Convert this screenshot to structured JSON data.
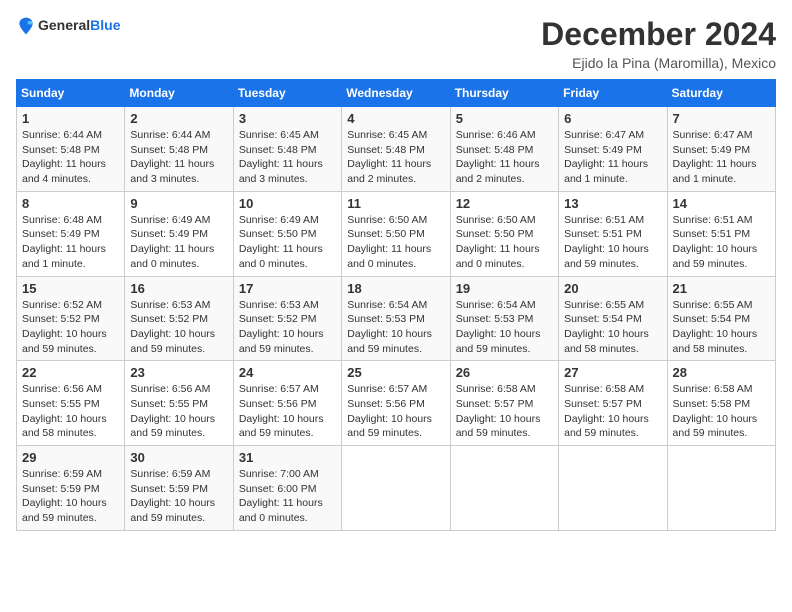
{
  "header": {
    "logo_general": "General",
    "logo_blue": "Blue",
    "title": "December 2024",
    "subtitle": "Ejido la Pina (Maromilla), Mexico"
  },
  "calendar": {
    "columns": [
      "Sunday",
      "Monday",
      "Tuesday",
      "Wednesday",
      "Thursday",
      "Friday",
      "Saturday"
    ],
    "weeks": [
      [
        null,
        null,
        null,
        null,
        null,
        null,
        null
      ]
    ],
    "days": {
      "1": {
        "sunrise": "6:44 AM",
        "sunset": "5:48 PM",
        "daylight": "11 hours and 4 minutes."
      },
      "2": {
        "sunrise": "6:44 AM",
        "sunset": "5:48 PM",
        "daylight": "11 hours and 3 minutes."
      },
      "3": {
        "sunrise": "6:45 AM",
        "sunset": "5:48 PM",
        "daylight": "11 hours and 3 minutes."
      },
      "4": {
        "sunrise": "6:45 AM",
        "sunset": "5:48 PM",
        "daylight": "11 hours and 2 minutes."
      },
      "5": {
        "sunrise": "6:46 AM",
        "sunset": "5:48 PM",
        "daylight": "11 hours and 2 minutes."
      },
      "6": {
        "sunrise": "6:47 AM",
        "sunset": "5:49 PM",
        "daylight": "11 hours and 1 minute."
      },
      "7": {
        "sunrise": "6:47 AM",
        "sunset": "5:49 PM",
        "daylight": "11 hours and 1 minute."
      },
      "8": {
        "sunrise": "6:48 AM",
        "sunset": "5:49 PM",
        "daylight": "11 hours and 1 minute."
      },
      "9": {
        "sunrise": "6:49 AM",
        "sunset": "5:49 PM",
        "daylight": "11 hours and 0 minutes."
      },
      "10": {
        "sunrise": "6:49 AM",
        "sunset": "5:50 PM",
        "daylight": "11 hours and 0 minutes."
      },
      "11": {
        "sunrise": "6:50 AM",
        "sunset": "5:50 PM",
        "daylight": "11 hours and 0 minutes."
      },
      "12": {
        "sunrise": "6:50 AM",
        "sunset": "5:50 PM",
        "daylight": "11 hours and 0 minutes."
      },
      "13": {
        "sunrise": "6:51 AM",
        "sunset": "5:51 PM",
        "daylight": "10 hours and 59 minutes."
      },
      "14": {
        "sunrise": "6:51 AM",
        "sunset": "5:51 PM",
        "daylight": "10 hours and 59 minutes."
      },
      "15": {
        "sunrise": "6:52 AM",
        "sunset": "5:52 PM",
        "daylight": "10 hours and 59 minutes."
      },
      "16": {
        "sunrise": "6:53 AM",
        "sunset": "5:52 PM",
        "daylight": "10 hours and 59 minutes."
      },
      "17": {
        "sunrise": "6:53 AM",
        "sunset": "5:52 PM",
        "daylight": "10 hours and 59 minutes."
      },
      "18": {
        "sunrise": "6:54 AM",
        "sunset": "5:53 PM",
        "daylight": "10 hours and 59 minutes."
      },
      "19": {
        "sunrise": "6:54 AM",
        "sunset": "5:53 PM",
        "daylight": "10 hours and 59 minutes."
      },
      "20": {
        "sunrise": "6:55 AM",
        "sunset": "5:54 PM",
        "daylight": "10 hours and 58 minutes."
      },
      "21": {
        "sunrise": "6:55 AM",
        "sunset": "5:54 PM",
        "daylight": "10 hours and 58 minutes."
      },
      "22": {
        "sunrise": "6:56 AM",
        "sunset": "5:55 PM",
        "daylight": "10 hours and 58 minutes."
      },
      "23": {
        "sunrise": "6:56 AM",
        "sunset": "5:55 PM",
        "daylight": "10 hours and 59 minutes."
      },
      "24": {
        "sunrise": "6:57 AM",
        "sunset": "5:56 PM",
        "daylight": "10 hours and 59 minutes."
      },
      "25": {
        "sunrise": "6:57 AM",
        "sunset": "5:56 PM",
        "daylight": "10 hours and 59 minutes."
      },
      "26": {
        "sunrise": "6:58 AM",
        "sunset": "5:57 PM",
        "daylight": "10 hours and 59 minutes."
      },
      "27": {
        "sunrise": "6:58 AM",
        "sunset": "5:57 PM",
        "daylight": "10 hours and 59 minutes."
      },
      "28": {
        "sunrise": "6:58 AM",
        "sunset": "5:58 PM",
        "daylight": "10 hours and 59 minutes."
      },
      "29": {
        "sunrise": "6:59 AM",
        "sunset": "5:59 PM",
        "daylight": "10 hours and 59 minutes."
      },
      "30": {
        "sunrise": "6:59 AM",
        "sunset": "5:59 PM",
        "daylight": "10 hours and 59 minutes."
      },
      "31": {
        "sunrise": "7:00 AM",
        "sunset": "6:00 PM",
        "daylight": "11 hours and 0 minutes."
      }
    }
  }
}
